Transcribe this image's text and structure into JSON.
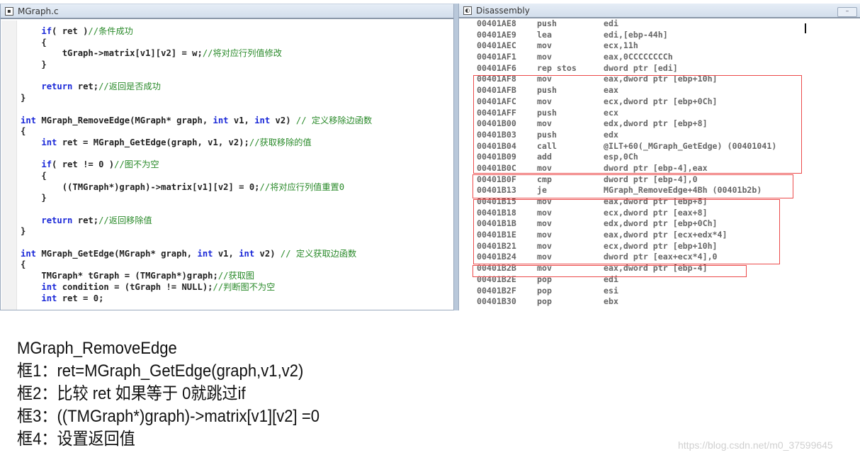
{
  "source_window": {
    "title": "MGraph.c",
    "icon": "c-source-file-icon",
    "lines": [
      [
        {
          "t": "    "
        },
        {
          "t": "if",
          "c": "kw"
        },
        {
          "t": "( ret )"
        },
        {
          "t": "//条件成功",
          "c": "cm"
        }
      ],
      [
        {
          "t": "    {"
        }
      ],
      [
        {
          "t": "        tGraph->matrix[v1][v2] = w;"
        },
        {
          "t": "//将对应行列值修改",
          "c": "cm"
        }
      ],
      [
        {
          "t": "    }"
        }
      ],
      [
        {
          "t": ""
        }
      ],
      [
        {
          "t": "    "
        },
        {
          "t": "return",
          "c": "kw"
        },
        {
          "t": " ret;"
        },
        {
          "t": "//返回是否成功",
          "c": "cm"
        }
      ],
      [
        {
          "t": "}"
        }
      ],
      [
        {
          "t": ""
        }
      ],
      [
        {
          "t": "int",
          "c": "kw"
        },
        {
          "t": " MGraph_RemoveEdge(MGraph* graph, "
        },
        {
          "t": "int",
          "c": "kw"
        },
        {
          "t": " v1, "
        },
        {
          "t": "int",
          "c": "kw"
        },
        {
          "t": " v2) "
        },
        {
          "t": "// 定义移除边函数",
          "c": "cm"
        }
      ],
      [
        {
          "t": "{"
        }
      ],
      [
        {
          "t": "    "
        },
        {
          "t": "int",
          "c": "kw"
        },
        {
          "t": " ret = MGraph_GetEdge(graph, v1, v2);"
        },
        {
          "t": "//获取移除的值",
          "c": "cm"
        }
      ],
      [
        {
          "t": ""
        }
      ],
      [
        {
          "t": "    "
        },
        {
          "t": "if",
          "c": "kw"
        },
        {
          "t": "( ret != 0 )"
        },
        {
          "t": "//图不为空",
          "c": "cm"
        }
      ],
      [
        {
          "t": "    {"
        }
      ],
      [
        {
          "t": "        ((TMGraph*)graph)->matrix[v1][v2] = 0;"
        },
        {
          "t": "//将对应行列值重置0",
          "c": "cm"
        }
      ],
      [
        {
          "t": "    }"
        }
      ],
      [
        {
          "t": ""
        }
      ],
      [
        {
          "t": "    "
        },
        {
          "t": "return",
          "c": "kw"
        },
        {
          "t": " ret;"
        },
        {
          "t": "//返回移除值",
          "c": "cm"
        }
      ],
      [
        {
          "t": "}"
        }
      ],
      [
        {
          "t": ""
        }
      ],
      [
        {
          "t": "int",
          "c": "kw"
        },
        {
          "t": " MGraph_GetEdge(MGraph* graph, "
        },
        {
          "t": "int",
          "c": "kw"
        },
        {
          "t": " v1, "
        },
        {
          "t": "int",
          "c": "kw"
        },
        {
          "t": " v2) "
        },
        {
          "t": "// 定义获取边函数",
          "c": "cm"
        }
      ],
      [
        {
          "t": "{"
        }
      ],
      [
        {
          "t": "    TMGraph* tGraph = (TMGraph*)graph;"
        },
        {
          "t": "//获取图",
          "c": "cm"
        }
      ],
      [
        {
          "t": "    "
        },
        {
          "t": "int",
          "c": "kw"
        },
        {
          "t": " condition = (tGraph != NULL);"
        },
        {
          "t": "//判断图不为空",
          "c": "cm"
        }
      ],
      [
        {
          "t": "    "
        },
        {
          "t": "int",
          "c": "kw"
        },
        {
          "t": " ret = 0;"
        }
      ]
    ]
  },
  "disassembly_window": {
    "title": "Disassembly",
    "icon": "disassembly-icon",
    "minimize_icon": "minimize-icon",
    "rows": [
      [
        "00401AE8",
        "push",
        "edi"
      ],
      [
        "00401AE9",
        "lea",
        "edi,[ebp-44h]"
      ],
      [
        "00401AEC",
        "mov",
        "ecx,11h"
      ],
      [
        "00401AF1",
        "mov",
        "eax,0CCCCCCCCh"
      ],
      [
        "00401AF6",
        "rep stos",
        "dword ptr [edi]"
      ],
      [
        "00401AF8",
        "mov",
        "eax,dword ptr [ebp+10h]"
      ],
      [
        "00401AFB",
        "push",
        "eax"
      ],
      [
        "00401AFC",
        "mov",
        "ecx,dword ptr [ebp+0Ch]"
      ],
      [
        "00401AFF",
        "push",
        "ecx"
      ],
      [
        "00401B00",
        "mov",
        "edx,dword ptr [ebp+8]"
      ],
      [
        "00401B03",
        "push",
        "edx"
      ],
      [
        "00401B04",
        "call",
        "@ILT+60(_MGraph_GetEdge) (00401041)"
      ],
      [
        "00401B09",
        "add",
        "esp,0Ch"
      ],
      [
        "00401B0C",
        "mov",
        "dword ptr [ebp-4],eax"
      ],
      [
        "00401B0F",
        "cmp",
        "dword ptr [ebp-4],0"
      ],
      [
        "00401B13",
        "je",
        "MGraph_RemoveEdge+4Bh (00401b2b)"
      ],
      [
        "00401B15",
        "mov",
        "eax,dword ptr [ebp+8]"
      ],
      [
        "00401B18",
        "mov",
        "ecx,dword ptr [eax+8]"
      ],
      [
        "00401B1B",
        "mov",
        "edx,dword ptr [ebp+0Ch]"
      ],
      [
        "00401B1E",
        "mov",
        "eax,dword ptr [ecx+edx*4]"
      ],
      [
        "00401B21",
        "mov",
        "ecx,dword ptr [ebp+10h]"
      ],
      [
        "00401B24",
        "mov",
        "dword ptr [eax+ecx*4],0"
      ],
      [
        "00401B2B",
        "mov",
        "eax,dword ptr [ebp-4]"
      ],
      [
        "00401B2E",
        "pop",
        "edi"
      ],
      [
        "00401B2F",
        "pop",
        "esi"
      ],
      [
        "00401B30",
        "pop",
        "ebx"
      ]
    ],
    "highlight_color": "#ec4a4a"
  },
  "notes": [
    "MGraph_RemoveEdge",
    "框1：ret=MGraph_GetEdge(graph,v1,v2)",
    "框2：比较 ret 如果等于 0就跳过if",
    "框3：((TMGraph*)graph)->matrix[v1][v2]  =0",
    "框4：设置返回值"
  ],
  "watermark": "https://blog.csdn.net/m0_37599645"
}
